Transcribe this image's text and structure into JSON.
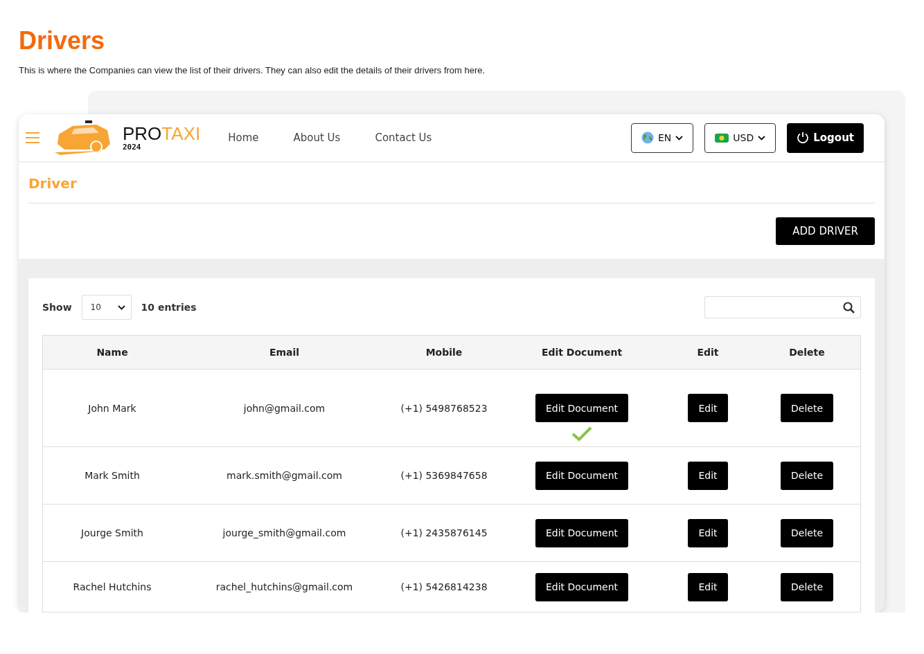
{
  "page": {
    "title": "Drivers",
    "description": "This is where the Companies can view the list of their drivers. They can also edit the details of their drivers from here."
  },
  "navbar": {
    "brand_main": "PRO",
    "brand_accent": "TAXI",
    "brand_year": "2024",
    "links": [
      "Home",
      "About Us",
      "Contact Us"
    ],
    "language": "EN",
    "currency": "USD",
    "logout": "Logout"
  },
  "section": {
    "title": "Driver",
    "add_button": "ADD DRIVER"
  },
  "table_controls": {
    "show_label": "Show",
    "page_size": "10",
    "entries_label": "10 entries"
  },
  "table": {
    "columns": [
      "Name",
      "Email",
      "Mobile",
      "Edit Document",
      "Edit",
      "Delete"
    ],
    "rows": [
      {
        "name": "John Mark",
        "email": "john@gmail.com",
        "mobile": "(+1) 5498768523",
        "edit_document": "Edit Document",
        "edit": "Edit",
        "delete": "Delete",
        "verified": true
      },
      {
        "name": "Mark Smith",
        "email": "mark.smith@gmail.com",
        "mobile": "(+1) 5369847658",
        "edit_document": "Edit Document",
        "edit": "Edit",
        "delete": "Delete",
        "verified": false
      },
      {
        "name": "Jourge Smith",
        "email": "jourge_smith@gmail.com",
        "mobile": "(+1) 2435876145",
        "edit_document": "Edit Document",
        "edit": "Edit",
        "delete": "Delete",
        "verified": false
      },
      {
        "name": "Rachel Hutchins",
        "email": "rachel_hutchins@gmail.com",
        "mobile": "(+1) 5426814238",
        "edit_document": "Edit Document",
        "edit": "Edit",
        "delete": "Delete",
        "verified": false
      }
    ]
  }
}
